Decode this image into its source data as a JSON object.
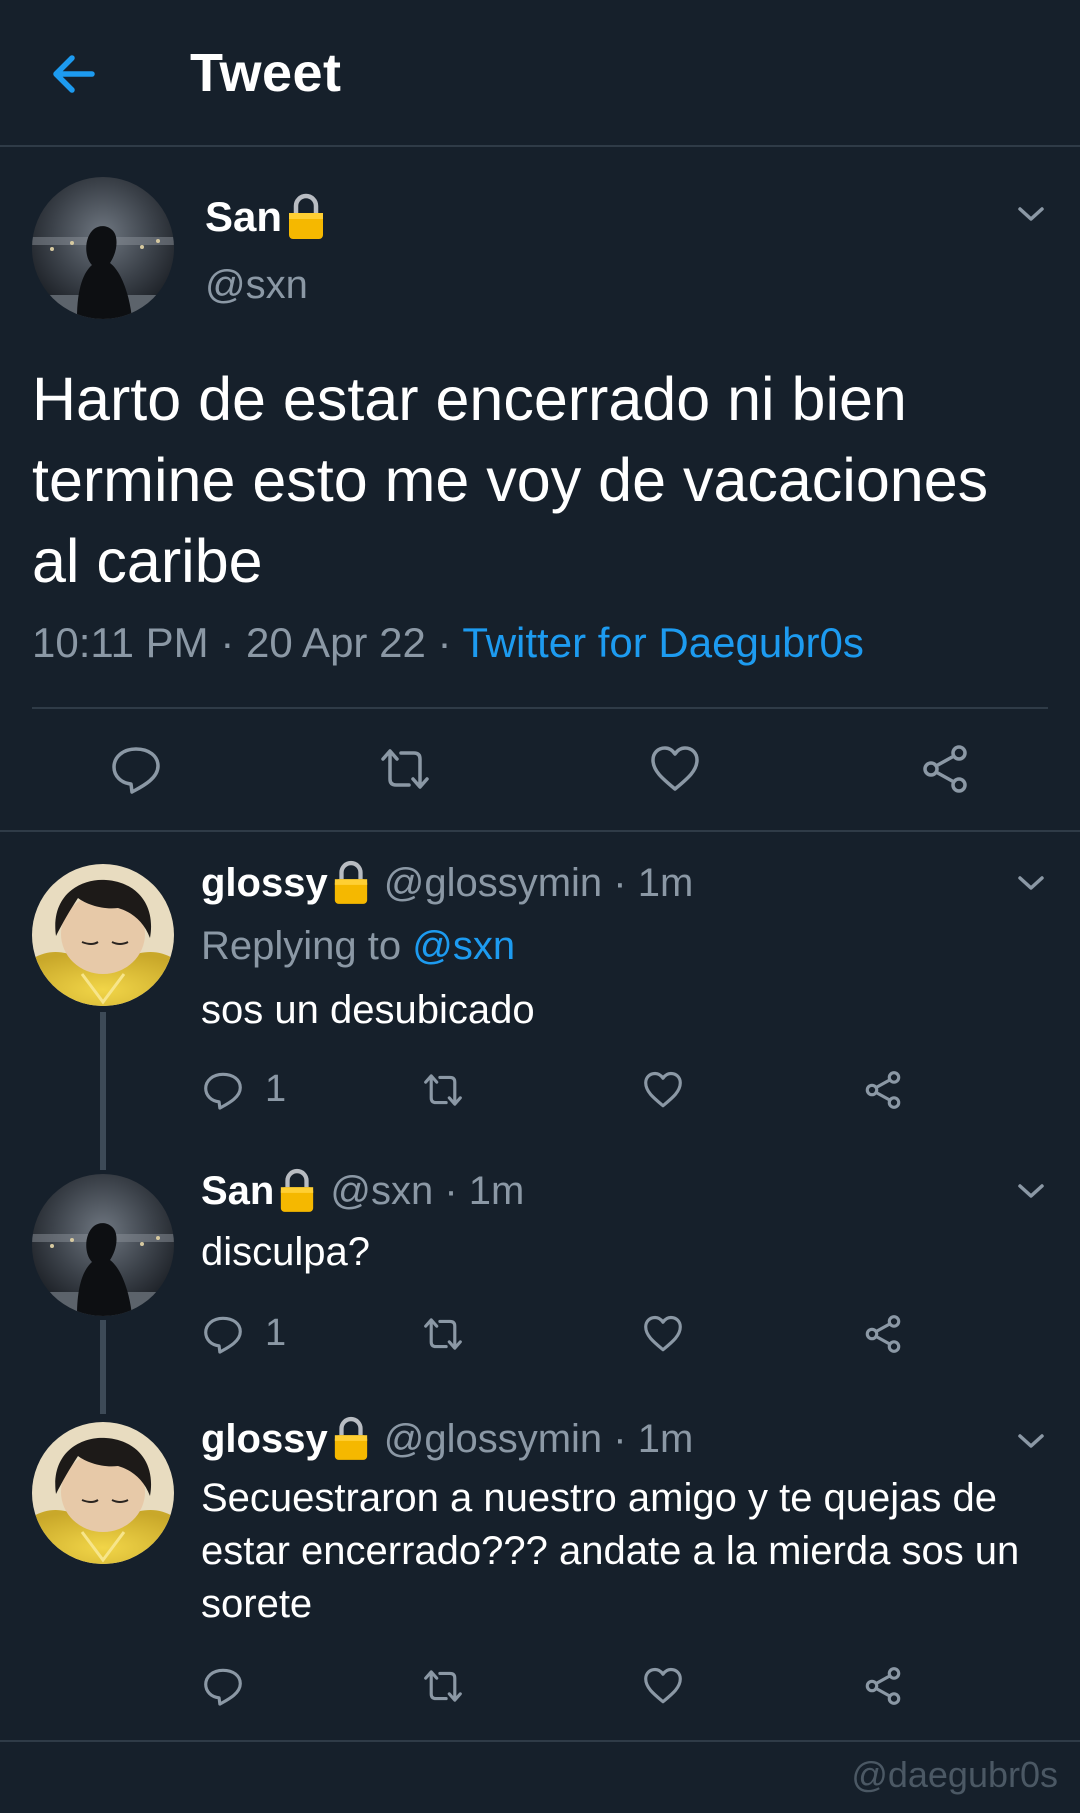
{
  "header": {
    "title": "Tweet"
  },
  "main_tweet": {
    "name": "San",
    "handle": "@sxn",
    "text": "Harto de estar encerrado ni bien termine esto me voy de vacaciones al caribe",
    "time": "10:11 PM",
    "date": "20 Apr 22",
    "source": "Twitter for Daegubr0s",
    "meta_sep1": " · ",
    "meta_sep2": " · "
  },
  "replies": [
    {
      "name": "glossy",
      "handle": "@glossymin · 1m",
      "replying_prefix": "Replying to ",
      "replying_to": "@sxn",
      "text": "sos un desubicado",
      "reply_count": "1"
    },
    {
      "name": "San",
      "handle": "@sxn · 1m",
      "text": "disculpa?",
      "reply_count": "1"
    },
    {
      "name": "glossy",
      "handle": "@glossymin · 1m",
      "text": "Secuestraron a nuestro amigo y te quejas de estar encerrado??? andate a la mierda sos un sorete"
    }
  ],
  "watermark": "@daegubr0s",
  "colors": {
    "background": "#16202b",
    "accent": "#1d9bf0",
    "muted": "#8b98a5",
    "divider": "#2f3b47"
  }
}
